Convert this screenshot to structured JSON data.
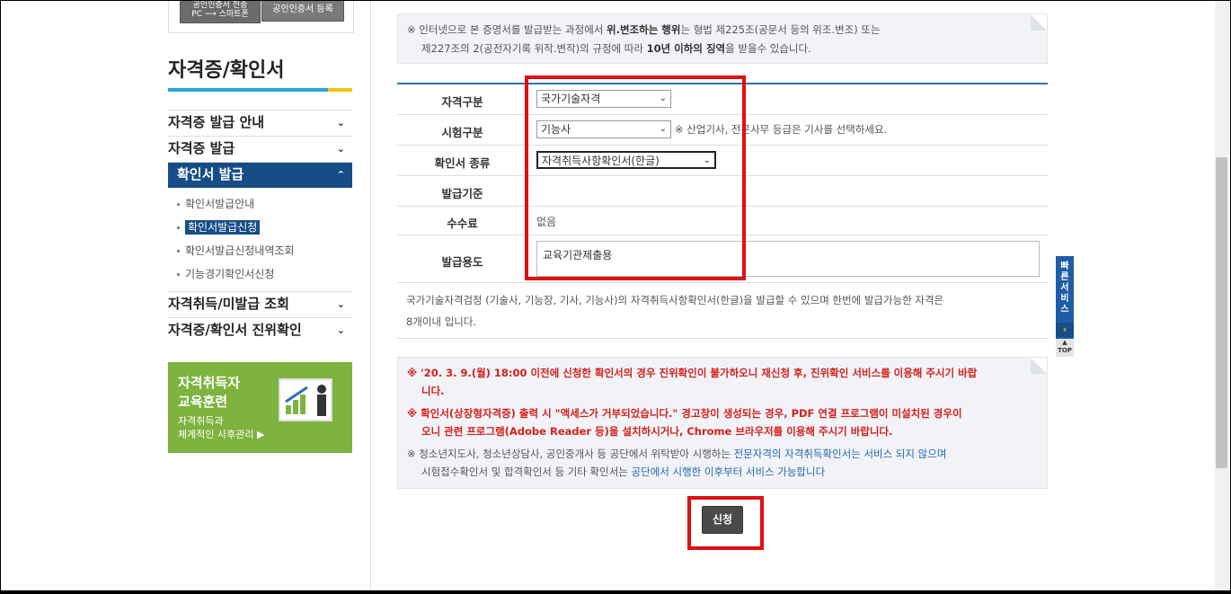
{
  "top_banners": {
    "b1_line1": "공인인증서 전송",
    "b1_line2": "PC ⟶ 스마트폰",
    "b2": "공인인증서 등록"
  },
  "sidebar": {
    "title": "자격증/확인서",
    "menu": [
      {
        "label": "자격증 발급 안내",
        "chev": "⌄"
      },
      {
        "label": "자격증 발급",
        "chev": "⌄"
      },
      {
        "label": "확인서 발급",
        "chev": "⌃"
      }
    ],
    "sub": [
      "확인서발급안내",
      "확인서발급신청",
      "확인서발급신청내역조회",
      "기능경기확인서신청"
    ],
    "menu2": [
      {
        "label": "자격취득/미발급 조회",
        "chev": "⌄"
      },
      {
        "label": "자격증/확인서 진위확인",
        "chev": "⌄"
      }
    ],
    "promo": {
      "t1": "자격취득자",
      "t2": "교육훈련",
      "t3": "자격취득과",
      "t4": "체계적인 사후관리"
    }
  },
  "notice1": {
    "l1_a": "※ 인터넷으로 본 증명서를 발급받는 과정에서 ",
    "l1_b": "위.변조하는 행위",
    "l1_c": "는 형법 제225조(공문서 등의 위조.변조) 또는",
    "l2_a": "제227조의 2(공전자기록 위작.변작)의 규정에 따라 ",
    "l2_b": "10년 이하의 징역",
    "l2_c": "을 받을수 있습니다."
  },
  "form": {
    "qual_type": {
      "label": "자격구분",
      "value": "국가기술자격"
    },
    "exam_type": {
      "label": "시험구분",
      "value": "기능사",
      "hint": "※ 산업기사, 전문사무 등급은 기사를 선택하세요."
    },
    "cert_kind": {
      "label": "확인서 종류",
      "value": "자격취득사항확인서(한글)"
    },
    "basis": {
      "label": "발급기준"
    },
    "fee": {
      "label": "수수료",
      "value": "없음"
    },
    "purpose": {
      "label": "발급용도",
      "value": "교육기관제출용"
    }
  },
  "description": {
    "l1": "국가기술자격검정 (기술사, 기능장, 기사, 기능사)의 자격취득사항확인서(한글)을 발급할 수 있으며 한번에 발급가능한 자격은",
    "l2": "8개이내 입니다."
  },
  "notice2": {
    "r1a": "※ '20. 3. 9.(월) 18:00 이전에 신청한 확인서의 경우 진위확인이 불가하오니 재신청 후, 진위확인 서비스를 이용해 주시기 바랍",
    "r1b": "니다.",
    "r2a": "※ 확인서(상장형자격증) 출력 시 \"액세스가 거부되었습니다.\" 경고창이 생성되는 경우, PDF 연결 프로그램이 미설치된 경우이",
    "r2b": "오니 관련 프로그램(Adobe Reader 등)을 설치하시거나, Chrome 브라우저를 이용해 주시기 바랍니다.",
    "g1a": "※ 청소년지도사, 청소년상담사, 공인중개사 등 공단에서 위탁받아 시행하는 ",
    "g1b": "전문자격의 자격취득확인서는 서비스 되지 않으며",
    "g2a": "시험접수확인서 및 합격확인서 등 기타 확인서는 ",
    "g2b": "공단에서 시행한 이후부터 서비스 가능합니다"
  },
  "submit_label": "신청",
  "quick": {
    "label": "빠른서비스",
    "top": "TOP"
  }
}
